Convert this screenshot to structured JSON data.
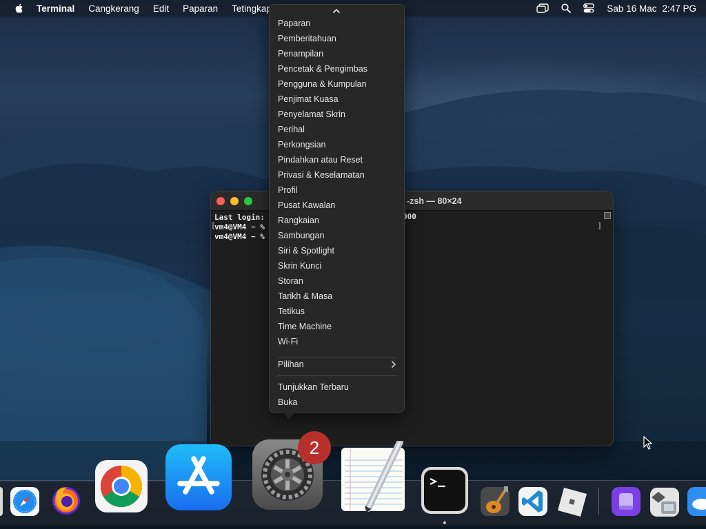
{
  "menubar": {
    "app_name": "Terminal",
    "items": [
      "Cangkerang",
      "Edit",
      "Paparan",
      "Tetingkap"
    ],
    "date": "Sab 16 Mac",
    "time": "2:47 PG"
  },
  "dropdown": {
    "items": [
      "Paparan",
      "Pemberitahuan",
      "Penampilan",
      "Pencetak & Pengimbas",
      "Pengguna & Kumpulan",
      "Penjimat Kuasa",
      "Penyelamat Skrin",
      "Perihal",
      "Perkongsian",
      "Pindahkan atau Reset",
      "Privasi & Keselamatan",
      "Profil",
      "Pusat Kawalan",
      "Rangkaian",
      "Sambungan",
      "Siri & Spotlight",
      "Skrin Kunci",
      "Storan",
      "Tarikh & Masa",
      "Tetikus",
      "Time Machine",
      "Wi-Fi"
    ],
    "options_label": "Pilihan",
    "show_recent_label": "Tunjukkan Terbaru",
    "open_label": "Buka"
  },
  "terminal": {
    "title_tail": "-zsh — 80×24",
    "lines": [
      "Last login:",
      "vm4@VM4 ~ %",
      "vm4@VM4 ~ %"
    ],
    "line1_tail": "000"
  },
  "dock": {
    "system_settings_badge": "2",
    "icons": [
      "safari-icon",
      "firefox-icon",
      "chrome-icon",
      "app-store-icon",
      "system-settings-icon",
      "textedit-icon",
      "terminal-icon",
      "garageband-icon",
      "vscode-icon",
      "roblox-icon",
      "podcast-icon",
      "migration-icon",
      "weather-icon"
    ]
  }
}
